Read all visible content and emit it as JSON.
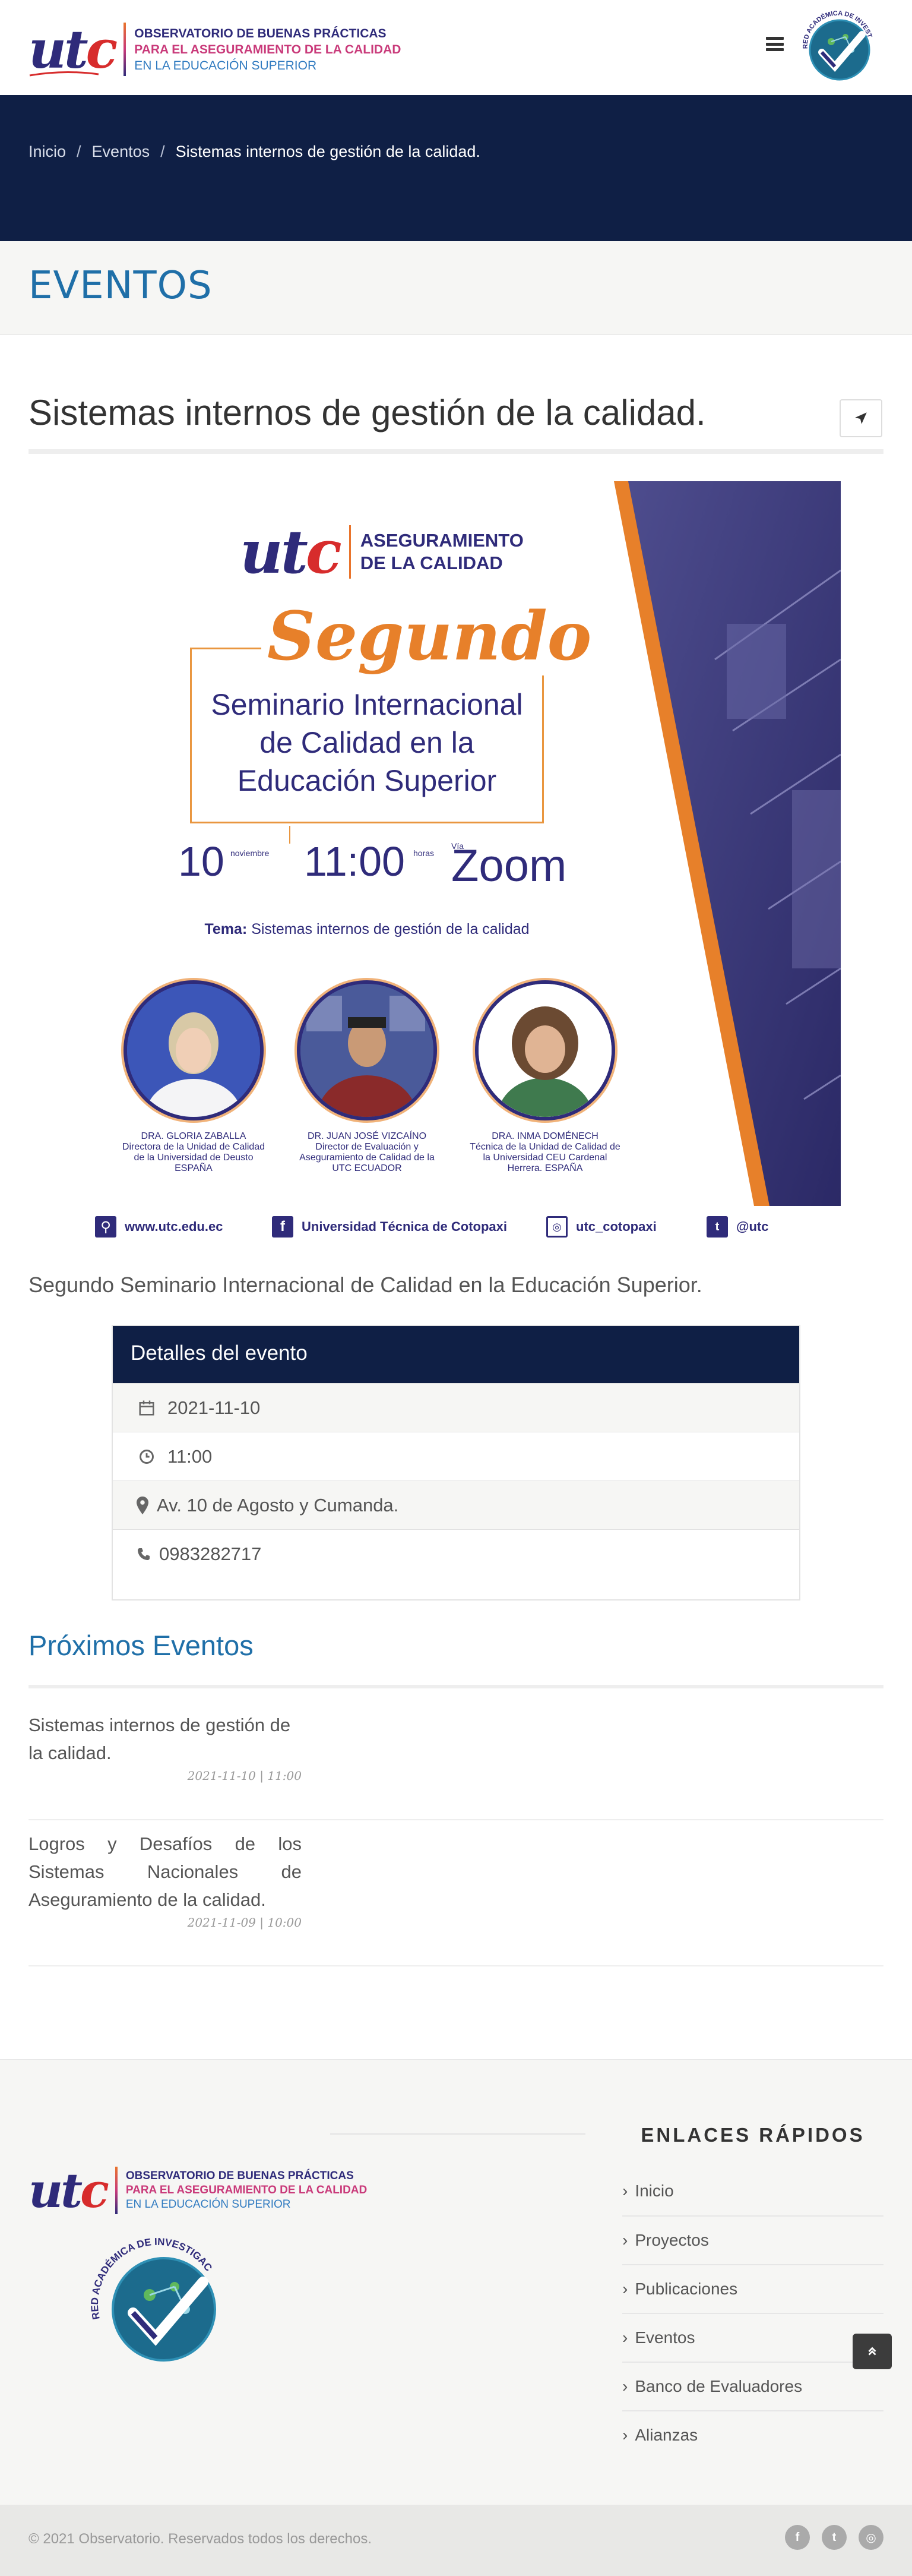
{
  "header": {
    "logo_text": "utc",
    "brand_line1": "OBSERVATORIO DE BUENAS PRÁCTICAS",
    "brand_line2": "PARA EL ASEGURAMIENTO DE LA CALIDAD",
    "brand_line3": "EN LA EDUCACIÓN SUPERIOR",
    "badge_text": "RED ACADÉMICA DE INVESTIGACIÓN EN CALIDAD"
  },
  "breadcrumb": {
    "items": [
      "Inicio",
      "Eventos"
    ],
    "current": "Sistemas internos de gestión de la calidad.",
    "separator": "/"
  },
  "section": {
    "title": "EVENTOS"
  },
  "article": {
    "title": "Sistemas internos de gestión de la calidad.",
    "lead": "Segundo Seminario Internacional de Calidad en la Educación Superior."
  },
  "poster": {
    "header_line1": "ASEGURAMIENTO",
    "header_line2": "DE LA CALIDAD",
    "script_title": "Segundo",
    "title_line1": "Seminario Internacional",
    "title_line2": "de Calidad en la",
    "title_line3": "Educación Superior",
    "day": "10",
    "month": "noviembre",
    "time": "11:00",
    "time_unit": "horas",
    "via": "Vía",
    "platform": "Zoom",
    "tema_label": "Tema:",
    "tema_value": " Sistemas internos de gestión de la calidad",
    "speakers": [
      {
        "name": "DRA. GLORIA ZABALLA",
        "role": "Directora de la Unidad de Calidad de la Universidad de Deusto ESPAÑA"
      },
      {
        "name": "DR. JUAN JOSÉ VIZCAÍNO",
        "role": "Director de Evaluación y Aseguramiento de Calidad de la UTC ECUADOR"
      },
      {
        "name": "DRA. INMA DOMÉNECH",
        "role": "Técnica de la Unidad de Calidad de la Universidad CEU Cardenal Herrera. ESPAÑA"
      }
    ],
    "socials": [
      "www.utc.edu.ec",
      "Universidad Técnica de Cotopaxi",
      "utc_cotopaxi",
      "@utc"
    ]
  },
  "details": {
    "heading": "Detalles del evento",
    "date": "2021-11-10",
    "time": "11:00",
    "address": "Av. 10 de Agosto y Cumanda.",
    "phone": "0983282717"
  },
  "upcoming": {
    "title": "Próximos Eventos",
    "events": [
      {
        "title": "Sistemas internos de gestión de la calidad.",
        "meta": "2021-11-10 | 11:00"
      },
      {
        "title": "Logros y Desafíos de los Sistemas Nacionales de Aseguramiento de la calidad.",
        "meta": "2021-11-09 | 10:00"
      }
    ]
  },
  "footer": {
    "links_title": "ENLACES RÁPIDOS",
    "links": [
      "Inicio",
      "Proyectos",
      "Publicaciones",
      "Eventos",
      "Banco de Evaluadores",
      "Alianzas"
    ],
    "copyright": "© 2021 Observatorio. Reservados todos los derechos.",
    "social_icons": [
      "facebook-icon",
      "twitter-icon",
      "instagram-icon"
    ]
  },
  "colors": {
    "navy": "#0f1f45",
    "accent_blue": "#1f6fa8",
    "poster_purple": "#2f2b7a",
    "poster_orange": "#e7802a"
  }
}
